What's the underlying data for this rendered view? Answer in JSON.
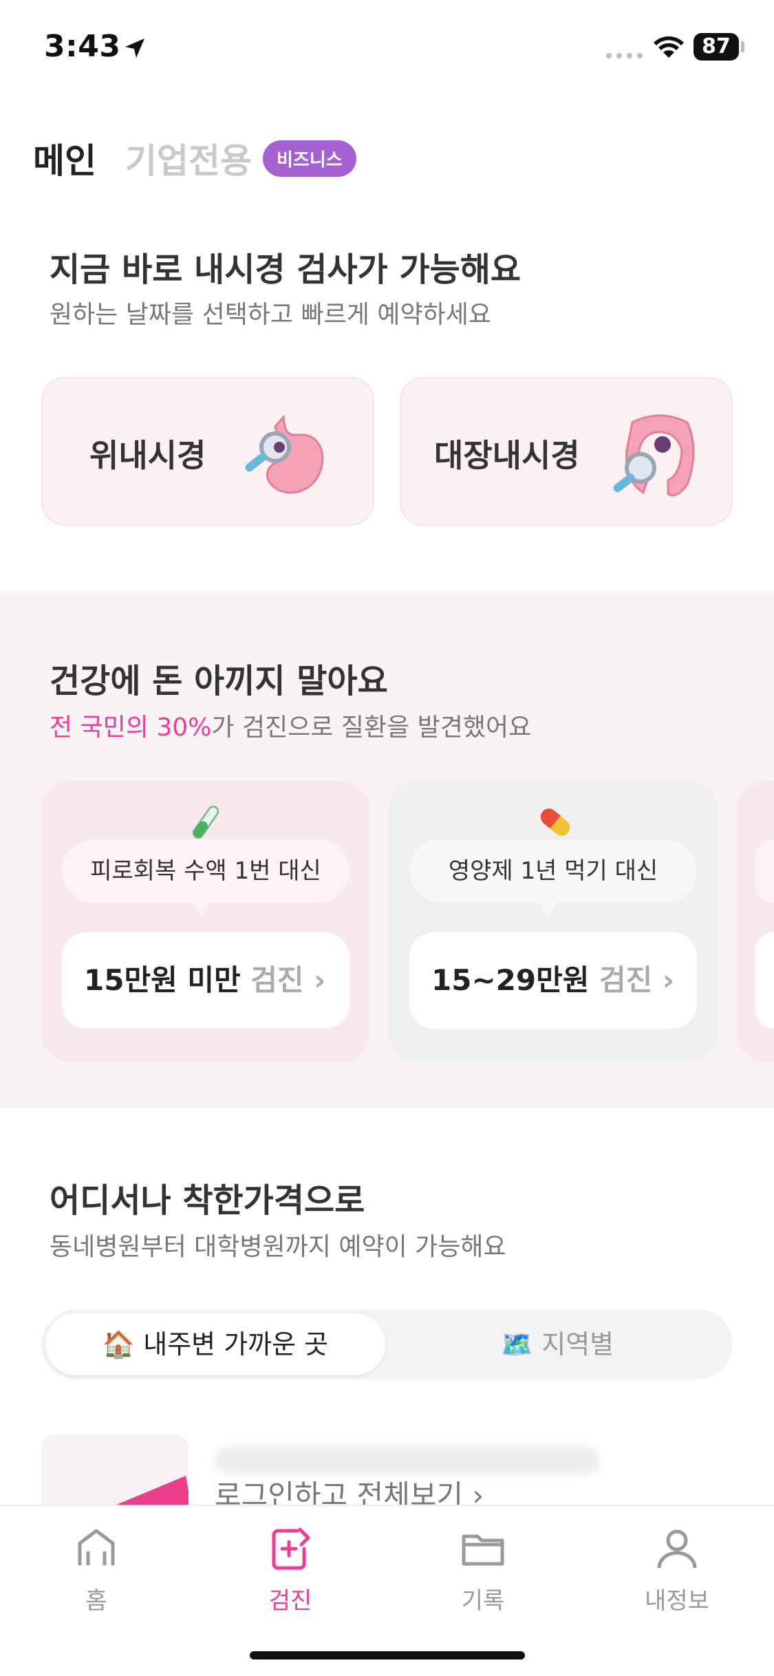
{
  "status_bar": {
    "time": "3:43",
    "battery": "87"
  },
  "top_tabs": {
    "main": "메인",
    "corporate": "기업전용",
    "business_badge": "비즈니스"
  },
  "endoscopy": {
    "title": "지금 바로 내시경 검사가 가능해요",
    "subtitle": "원하는 날짜를 선택하고 빠르게 예약하세요",
    "cards": [
      {
        "label": "위내시경",
        "icon": "stomach-icon"
      },
      {
        "label": "대장내시경",
        "icon": "colon-icon"
      }
    ]
  },
  "savings": {
    "title": "건강에 돈 아끼지 말아요",
    "subtitle_accent": "전 국민의 30%",
    "subtitle_rest": "가 검진으로 질환을 발견했어요",
    "cards": [
      {
        "emoji": "test-tube-icon",
        "bubble": "피로회복 수액 1번 대신",
        "price": "15만원 미만",
        "suffix": "검진",
        "chevron": "›"
      },
      {
        "emoji": "pill-icon",
        "bubble": "영양제 1년 먹기 대신",
        "price": "15~29만원",
        "suffix": "검진",
        "chevron": "›"
      }
    ]
  },
  "affordable": {
    "title": "어디서나 착한가격으로",
    "subtitle": "동네병원부터 대학병원까지 예약이 가능해요",
    "segment": {
      "nearby": "🏠 내주변 가까운 곳",
      "region": "🗺️ 지역별"
    },
    "login_link": "로그인하고 전체보기 ›"
  },
  "bottom_nav": [
    {
      "label": "홈",
      "icon": "home-icon",
      "active": false
    },
    {
      "label": "검진",
      "icon": "checkup-icon",
      "active": true
    },
    {
      "label": "기록",
      "icon": "folder-icon",
      "active": false
    },
    {
      "label": "내정보",
      "icon": "person-icon",
      "active": false
    }
  ],
  "colors": {
    "accent": "#ee3c98",
    "badge": "#a561d1",
    "band": "#faf3f5"
  }
}
